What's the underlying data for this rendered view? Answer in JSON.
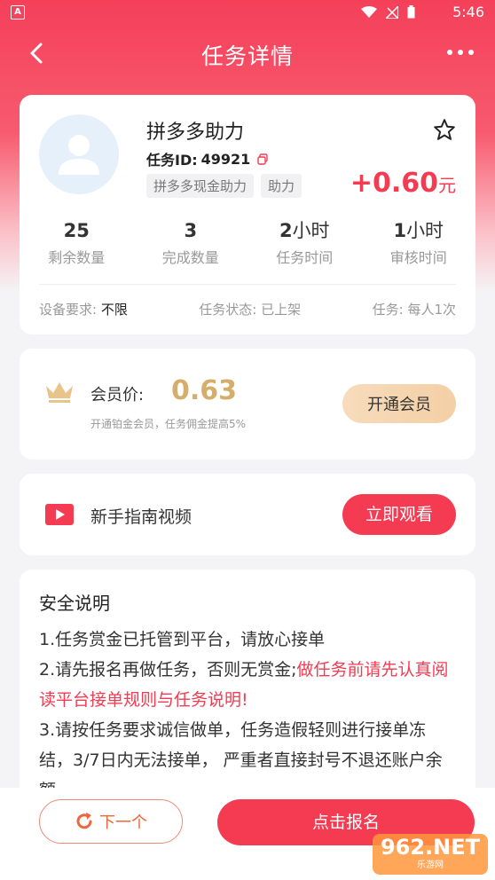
{
  "status_bar": {
    "time": "5:46",
    "app_badge": "A"
  },
  "nav": {
    "title": "任务详情"
  },
  "task": {
    "name": "拼多多助力",
    "id_label": "任务ID:",
    "id_value": "49921",
    "tags": [
      "拼多多现金助力",
      "助力"
    ],
    "reward_amount": "+0.60",
    "reward_unit": "元",
    "stats": [
      {
        "value": "25",
        "unit": "",
        "label": "剩余数量"
      },
      {
        "value": "3",
        "unit": "",
        "label": "完成数量"
      },
      {
        "value": "2",
        "unit": "小时",
        "label": "任务时间"
      },
      {
        "value": "1",
        "unit": "小时",
        "label": "审核时间"
      }
    ],
    "device_label": "设备要求:",
    "device_value": "不限",
    "status_label": "任务状态:",
    "status_value": "已上架",
    "limit_label": "任务:",
    "limit_value": "每人1次"
  },
  "vip": {
    "label": "会员价:",
    "price": "0.63",
    "desc": "开通铂金会员，任务佣金提高5%",
    "button": "开通会员",
    "crown_color": "#e8c38a"
  },
  "video": {
    "label": "新手指南视频",
    "button": "立即观看"
  },
  "safety": {
    "title": "安全说明",
    "line1": "1.任务赏金已托管到平台，请放心接单",
    "line2": "2.请先报名再做任务，否则无赏金;",
    "line2_red": "做任务前请先认真阅读平台接单规则与任务说明!",
    "line3": "3.请按任务要求诚信做单，任务造假轻则进行接单冻结，3/7日内无法接单， 严重者直接封号不退还账户余额"
  },
  "bottom": {
    "next_button": "下一个",
    "signup_button": "点击报名"
  },
  "watermark": {
    "text": "962.NET",
    "sub": "乐游网"
  },
  "colors": {
    "accent": "#f43b52",
    "gold": "#d4ae6a"
  }
}
